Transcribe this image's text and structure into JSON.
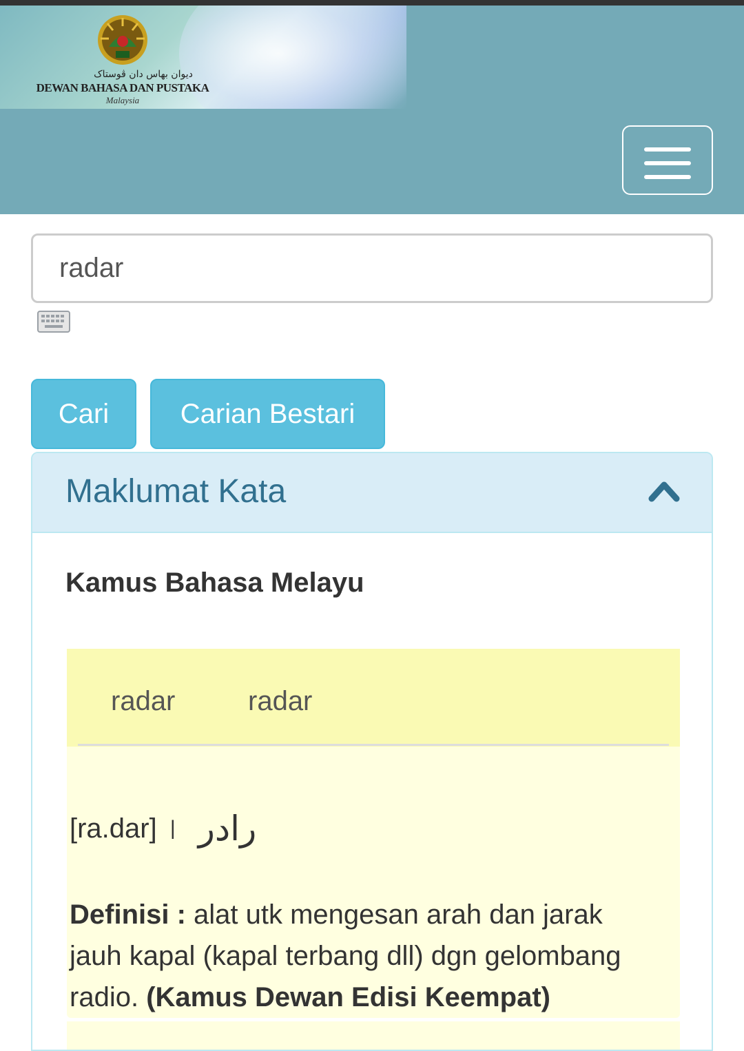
{
  "header": {
    "logo_jawi": "ديوان بهاس دان ڤوستاک",
    "logo_name": "DEWAN BAHASA DAN PUSTAKA",
    "logo_country": "Malaysia",
    "colors": {
      "header_bg": "#74aab7",
      "topstrip": "#333333"
    }
  },
  "search": {
    "value": "radar",
    "keyboard_icon": "keyboard-icon"
  },
  "buttons": {
    "search_label": "Cari",
    "smart_search_label": "Carian Bestari",
    "color": "#5bc0de"
  },
  "panel": {
    "title": "Maklumat Kata",
    "toggle_icon": "chevron-up-icon",
    "dictionary_title": "Kamus Bahasa Melayu",
    "tabs": [
      {
        "label": "radar"
      },
      {
        "label": "radar"
      }
    ],
    "entry": {
      "pronunciation": "[ra.dar]",
      "separator": "|",
      "jawi": "رادر",
      "definition_label": "Definisi :",
      "definition_text": "alat utk mengesan arah dan jarak jauh kapal (kapal terbang dll) dgn gelombang radio.",
      "source": "(Kamus Dewan Edisi Keempat)"
    },
    "colors": {
      "heading_bg": "#d9edf7",
      "heading_text": "#31708f",
      "tabs_bg": "#fafab4",
      "entry_bg": "#ffffe0"
    }
  }
}
